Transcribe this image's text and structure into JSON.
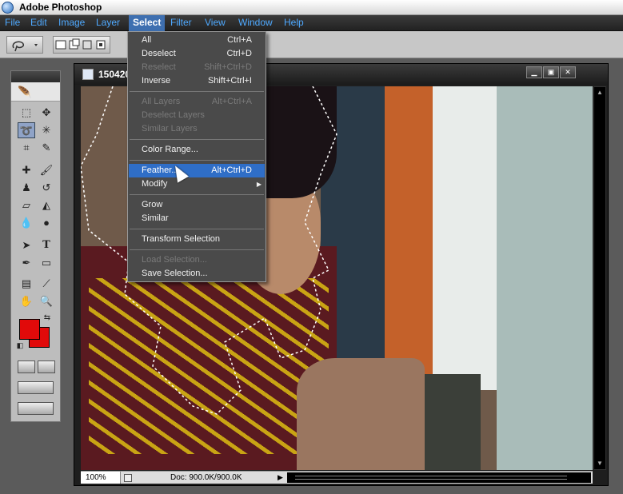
{
  "app": {
    "title": "Adobe Photoshop"
  },
  "menubar": {
    "items": [
      "File",
      "Edit",
      "Image",
      "Layer",
      "Select",
      "Filter",
      "View",
      "Window",
      "Help"
    ],
    "active": "Select"
  },
  "document": {
    "title": "150420",
    "zoom": "100%",
    "doc_size": "Doc: 900.0K/900.0K"
  },
  "select_menu": {
    "items": [
      {
        "label": "All",
        "shortcut": "Ctrl+A",
        "enabled": true
      },
      {
        "label": "Deselect",
        "shortcut": "Ctrl+D",
        "enabled": true
      },
      {
        "label": "Reselect",
        "shortcut": "Shift+Ctrl+D",
        "enabled": false
      },
      {
        "label": "Inverse",
        "shortcut": "Shift+Ctrl+I",
        "enabled": true
      },
      {
        "label": "All Layers",
        "shortcut": "Alt+Ctrl+A",
        "enabled": false
      },
      {
        "label": "Deselect Layers",
        "shortcut": "",
        "enabled": false
      },
      {
        "label": "Similar Layers",
        "shortcut": "",
        "enabled": false
      },
      {
        "label": "Color Range...",
        "shortcut": "",
        "enabled": true
      },
      {
        "label": "Feather...",
        "shortcut": "Alt+Ctrl+D",
        "enabled": true,
        "highlighted": true
      },
      {
        "label": "Modify",
        "shortcut": "",
        "enabled": true,
        "submenu": true
      },
      {
        "label": "Grow",
        "shortcut": "",
        "enabled": true
      },
      {
        "label": "Similar",
        "shortcut": "",
        "enabled": true
      },
      {
        "label": "Transform Selection",
        "shortcut": "",
        "enabled": true
      },
      {
        "label": "Load Selection...",
        "shortcut": "",
        "enabled": false
      },
      {
        "label": "Save Selection...",
        "shortcut": "",
        "enabled": true
      }
    ]
  },
  "toolbox": {
    "tools": [
      "marquee-tool",
      "move-tool",
      "lasso-tool",
      "magic-wand-tool",
      "crop-tool",
      "slice-tool",
      "healing-brush-tool",
      "brush-tool",
      "clone-stamp-tool",
      "history-brush-tool",
      "eraser-tool",
      "paint-bucket-tool",
      "blur-tool",
      "dodge-tool",
      "path-selection-tool",
      "type-tool",
      "pen-tool",
      "shape-tool",
      "notes-tool",
      "eyedropper-tool",
      "hand-tool",
      "zoom-tool"
    ],
    "foreground_color": "#e10a0a",
    "background_color": "#e10a0a"
  },
  "colors": {
    "menu_text": "#4ea9ff",
    "highlight": "#2f6ec7"
  }
}
